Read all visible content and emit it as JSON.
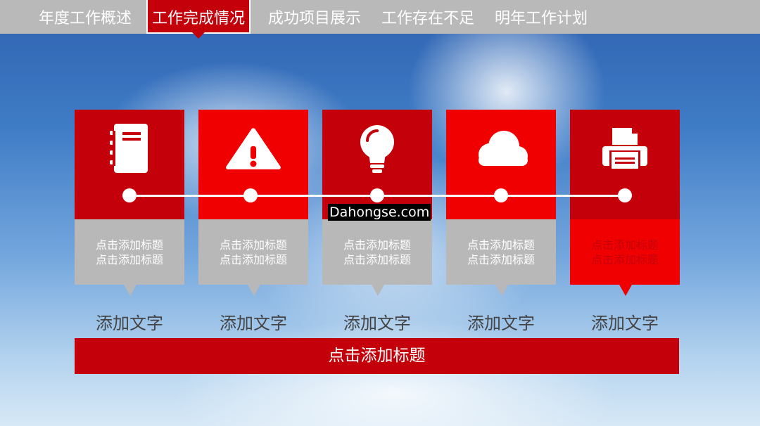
{
  "nav": {
    "items": [
      "年度工作概述",
      "工作完成情况",
      "成功项目展示",
      "工作存在不足",
      "明年工作计划"
    ],
    "active_index": 1
  },
  "cards": [
    {
      "icon": "document-icon",
      "title_line1": "点击添加标题",
      "title_line2": "点击添加标题",
      "caption": "添加文字"
    },
    {
      "icon": "warning-icon",
      "title_line1": "点击添加标题",
      "title_line2": "点击添加标题",
      "caption": "添加文字"
    },
    {
      "icon": "lightbulb-icon",
      "title_line1": "点击添加标题",
      "title_line2": "点击添加标题",
      "caption": "添加文字"
    },
    {
      "icon": "cloud-icon",
      "title_line1": "点击添加标题",
      "title_line2": "点击添加标题",
      "caption": "添加文字"
    },
    {
      "icon": "printer-icon",
      "title_line1": "点击添加标题",
      "title_line2": "点击添加标题",
      "caption": "添加文字"
    }
  ],
  "bottom_bar": {
    "label": "点击添加标题"
  },
  "watermark": "Dahongse.com",
  "colors": {
    "dark_red": "#c4000b",
    "bright_red": "#f00000",
    "gray": "#b8b8b8",
    "nav_bg": "#b9b9b9"
  }
}
